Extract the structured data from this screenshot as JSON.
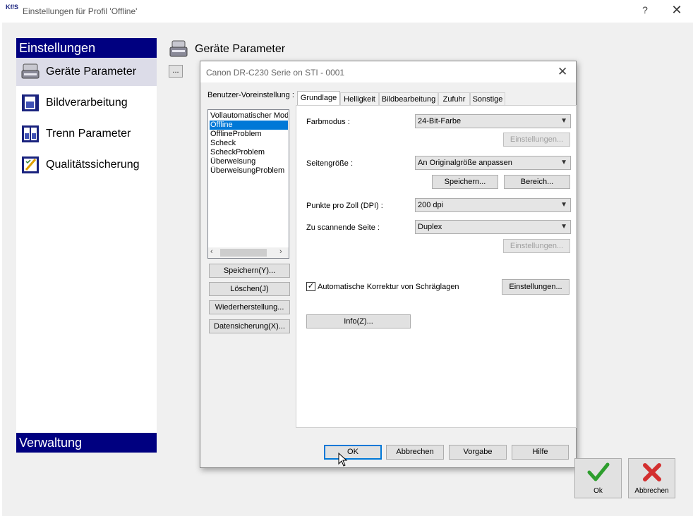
{
  "window": {
    "title": "Einstellungen für Profil 'Offline'",
    "app_icon_text": "Kf/S",
    "help_symbol": "?",
    "close_symbol": "✕"
  },
  "left_panel": {
    "header": "Einstellungen",
    "footer": "Verwaltung",
    "items": [
      {
        "label": "Geräte Parameter",
        "icon": "scanner-icon",
        "selected": true
      },
      {
        "label": "Bildverarbeitung",
        "icon": "image-book-icon",
        "selected": false
      },
      {
        "label": "Trenn Parameter",
        "icon": "split-pages-icon",
        "selected": false
      },
      {
        "label": "Qualitätssicherung",
        "icon": "quality-pencil-icon",
        "selected": false
      }
    ]
  },
  "main": {
    "section_title": "Geräte Parameter",
    "dots_button": "..."
  },
  "dialog": {
    "title": "Canon DR-C230 Serie on STI - 0001",
    "close_symbol": "✕",
    "preset_label": "Benutzer-Voreinstellung :",
    "presets": [
      "Vollautomatischer Modus",
      "Offline",
      "OfflineProblem",
      "Scheck",
      "ScheckProblem",
      "Überweisung",
      "ÜberweisungProblem"
    ],
    "selected_preset": "Offline",
    "scroll_left": "‹",
    "scroll_right": "›",
    "preset_buttons": {
      "save": "Speichern(Y)...",
      "delete": "Löschen(J)",
      "restore": "Wiederherstellung...",
      "backup": "Datensicherung(X)..."
    },
    "tabs": [
      "Grundlage",
      "Helligkeit",
      "Bildbearbeitung",
      "Zufuhr",
      "Sonstige"
    ],
    "active_tab": "Grundlage",
    "basic": {
      "color_mode_label": "Farbmodus :",
      "color_mode_value": "24-Bit-Farbe",
      "color_settings_button": "Einstellungen...",
      "page_size_label": "Seitengröße :",
      "page_size_value": "An Originalgröße anpassen",
      "save_size_button": "Speichern...",
      "area_button": "Bereich...",
      "dpi_label": "Punkte pro Zoll (DPI) :",
      "dpi_value": "200 dpi",
      "side_label": "Zu scannende Seite :",
      "side_value": "Duplex",
      "side_settings_button": "Einstellungen...",
      "deskew_label": "Automatische Korrektur von Schräglagen",
      "deskew_checked": true,
      "deskew_settings_button": "Einstellungen...",
      "info_button": "Info(Z)..."
    },
    "footer_buttons": {
      "ok": "OK",
      "cancel": "Abbrechen",
      "default": "Vorgabe",
      "help": "Hilfe"
    }
  },
  "window_buttons": {
    "ok": "Ok",
    "cancel": "Abbrechen"
  },
  "colors": {
    "header_blue": "#000080",
    "selection_blue": "#0078d7",
    "ok_green": "#2e9e2e",
    "cancel_red": "#d32f2f"
  }
}
